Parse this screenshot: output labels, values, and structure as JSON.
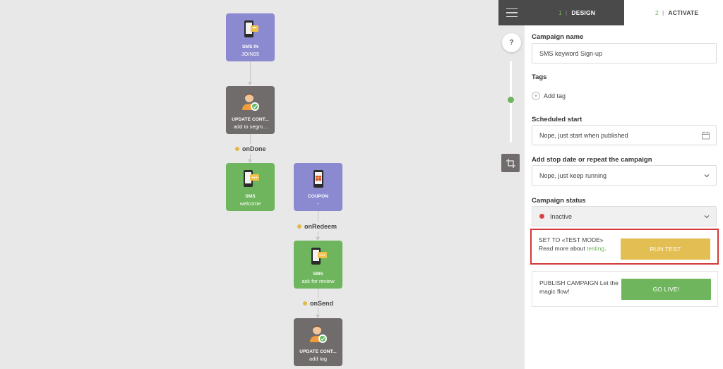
{
  "canvas": {
    "nodes": [
      {
        "title": "SMS IN",
        "sub": "JOIN55",
        "color": "purple",
        "icon": "phone-sms-in-icon"
      },
      {
        "title": "UPDATE CONT...",
        "sub": "add to segm...",
        "color": "gray",
        "icon": "contact-update-icon"
      },
      {
        "title": "SMS",
        "sub": "welcome",
        "color": "green",
        "icon": "phone-sms-icon"
      },
      {
        "title": "COUPON",
        "sub": "-",
        "color": "purple",
        "icon": "phone-coupon-icon"
      },
      {
        "title": "SMS",
        "sub": "ask for review",
        "color": "green",
        "icon": "phone-sms-icon"
      },
      {
        "title": "UPDATE CONT...",
        "sub": "add tag",
        "color": "gray",
        "icon": "contact-update-icon"
      }
    ],
    "events": [
      "onDone",
      "onRedeem",
      "onSend"
    ],
    "help": "?"
  },
  "topbar": {
    "tabs": [
      {
        "num": "1",
        "label": "DESIGN"
      },
      {
        "num": "2",
        "label": "ACTIVATE"
      }
    ]
  },
  "form": {
    "campaign_name_label": "Campaign name",
    "campaign_name_value": "SMS keyword Sign-up",
    "tags_label": "Tags",
    "add_tag": "Add tag",
    "scheduled_label": "Scheduled start",
    "scheduled_value": "Nope, just start when published",
    "stop_label": "Add stop date or repeat the campaign",
    "stop_value": "Nope, just keep running",
    "status_label": "Campaign status",
    "status_value": "Inactive"
  },
  "test_box": {
    "text_line": "SET TO «TEST MODE» Read more about",
    "link": "testing",
    "suffix": ".",
    "button": "RUN TEST"
  },
  "publish_box": {
    "text": "PUBLISH CAMPAIGN Let the magic flow!",
    "button": "GO LIVE!"
  },
  "colors": {
    "purple": "#8b8ad0",
    "gray": "#6f6c6b",
    "green": "#6fb55e",
    "event_dot": "#e2b94a",
    "run_test": "#e3be52",
    "status_dot": "#d64545",
    "highlight": "#d33a3a"
  }
}
